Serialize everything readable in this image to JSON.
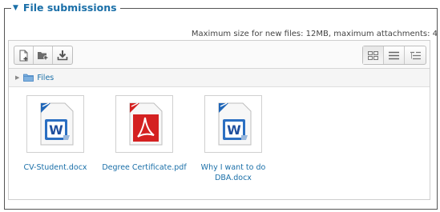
{
  "fieldset": {
    "title": "File submissions"
  },
  "limits": {
    "text": "Maximum size for new files: 12MB, maximum attachments: 4"
  },
  "toolbar": {
    "left": [
      {
        "name": "add-file-icon"
      },
      {
        "name": "create-folder-icon"
      },
      {
        "name": "download-icon"
      }
    ],
    "right": [
      {
        "name": "view-icons-icon",
        "active": true
      },
      {
        "name": "view-details-icon",
        "active": false
      },
      {
        "name": "view-tree-icon",
        "active": false
      }
    ]
  },
  "path": {
    "label": "Files"
  },
  "files": [
    {
      "name": "CV-Student.docx",
      "icon": "word-document-icon",
      "color": "#1f66b8"
    },
    {
      "name": "Degree Certificate.pdf",
      "icon": "pdf-document-icon",
      "color": "#d42121"
    },
    {
      "name": "Why I want to do DBA.docx",
      "icon": "word-document-icon",
      "color": "#1f66b8"
    }
  ],
  "colors": {
    "link": "#1a6fa8",
    "border": "#555555"
  }
}
